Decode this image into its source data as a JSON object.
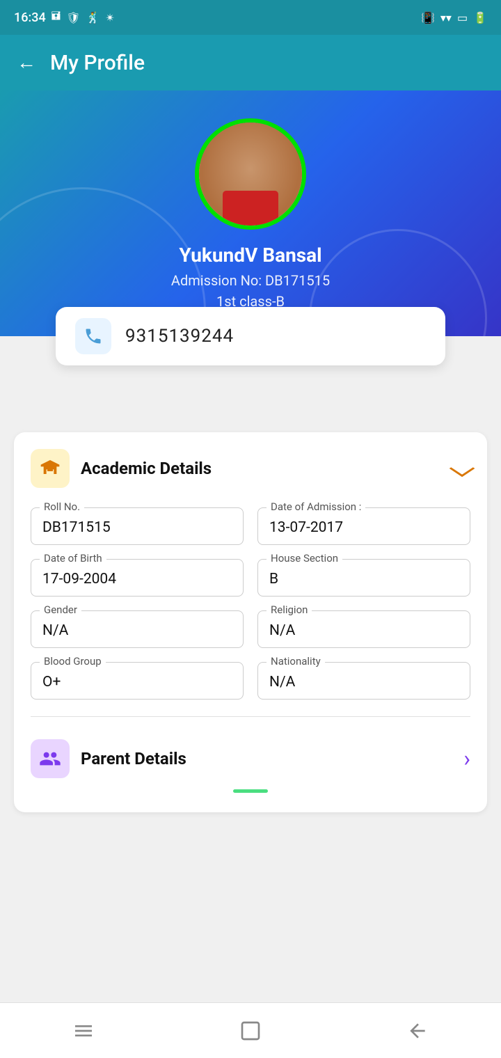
{
  "status_bar": {
    "time": "16:34",
    "icons_left": [
      "sim",
      "shield",
      "dancer",
      "bluetooth"
    ],
    "icons_right": [
      "vibrate",
      "wifi",
      "screen",
      "battery"
    ]
  },
  "header": {
    "back_label": "←",
    "title": "My Profile"
  },
  "hero": {
    "student_name": "YukundV Bansal",
    "admission_no": "Admission No: DB171515",
    "class_info": "1st class-B",
    "phone": "9315139244"
  },
  "academic_details": {
    "section_title": "Academic Details",
    "icon": "🏫",
    "chevron": "⌄",
    "fields": [
      {
        "label": "Roll No.",
        "value": "DB171515"
      },
      {
        "label": "Date of Admission :",
        "value": "13-07-2017"
      },
      {
        "label": "Date of Birth",
        "value": "17-09-2004"
      },
      {
        "label": "House Section",
        "value": "B"
      },
      {
        "label": "Gender",
        "value": "N/A"
      },
      {
        "label": "Religion",
        "value": "N/A"
      },
      {
        "label": "Blood Group",
        "value": "O+"
      },
      {
        "label": "Nationality",
        "value": "N/A"
      }
    ]
  },
  "parent_details": {
    "section_title": "Parent Details",
    "icon": "👨‍👩‍👧",
    "chevron": "›"
  },
  "bottom_nav": {
    "items": [
      "menu",
      "home",
      "back"
    ]
  }
}
